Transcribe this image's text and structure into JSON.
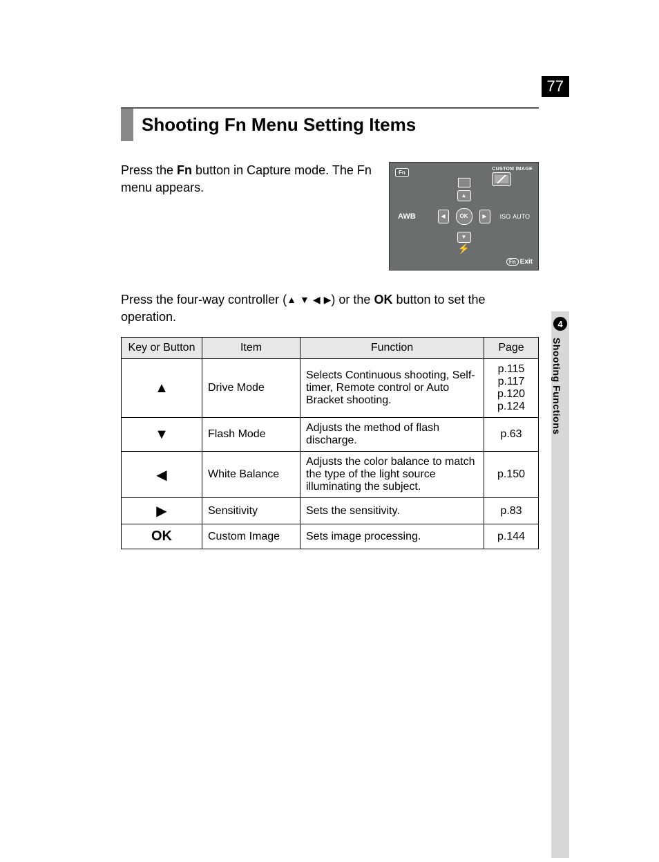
{
  "page_number": "77",
  "chapter_number": "4",
  "chapter_title": "Shooting Functions",
  "heading": "Shooting Fn Menu Setting Items",
  "intro": {
    "pre": "Press the ",
    "bold": "Fn",
    "post": " button in Capture mode. The Fn menu appears."
  },
  "lcd": {
    "fn": "Fn",
    "custom": "CUSTOM IMAGE",
    "ok": "OK",
    "awb": "AWB",
    "iso": "ISO",
    "iso_val": "AUTO",
    "exit": "Exit",
    "exit_fn": "Fn"
  },
  "second_para": {
    "pre": "Press the four-way controller (",
    "mid": ") or the ",
    "ok": "OK",
    "post": " button to set the operation."
  },
  "table": {
    "headers": {
      "key": "Key or Button",
      "item": "Item",
      "func": "Function",
      "page": "Page"
    },
    "rows": [
      {
        "key_sym": "▲",
        "item": "Drive Mode",
        "func": "Selects Continuous shooting, Self-timer, Remote control or Auto Bracket shooting.",
        "page": "p.115\np.117\np.120\np.124"
      },
      {
        "key_sym": "▼",
        "item": "Flash Mode",
        "func": "Adjusts the method of flash discharge.",
        "page": "p.63"
      },
      {
        "key_sym": "◀",
        "item": "White Balance",
        "func": "Adjusts the color balance to match the type of the light source illuminating the subject.",
        "page": "p.150"
      },
      {
        "key_sym": "▶",
        "item": "Sensitivity",
        "func": "Sets the sensitivity.",
        "page": "p.83"
      },
      {
        "key_sym": "OK",
        "item": "Custom Image",
        "func": "Sets image processing.",
        "page": "p.144"
      }
    ]
  }
}
